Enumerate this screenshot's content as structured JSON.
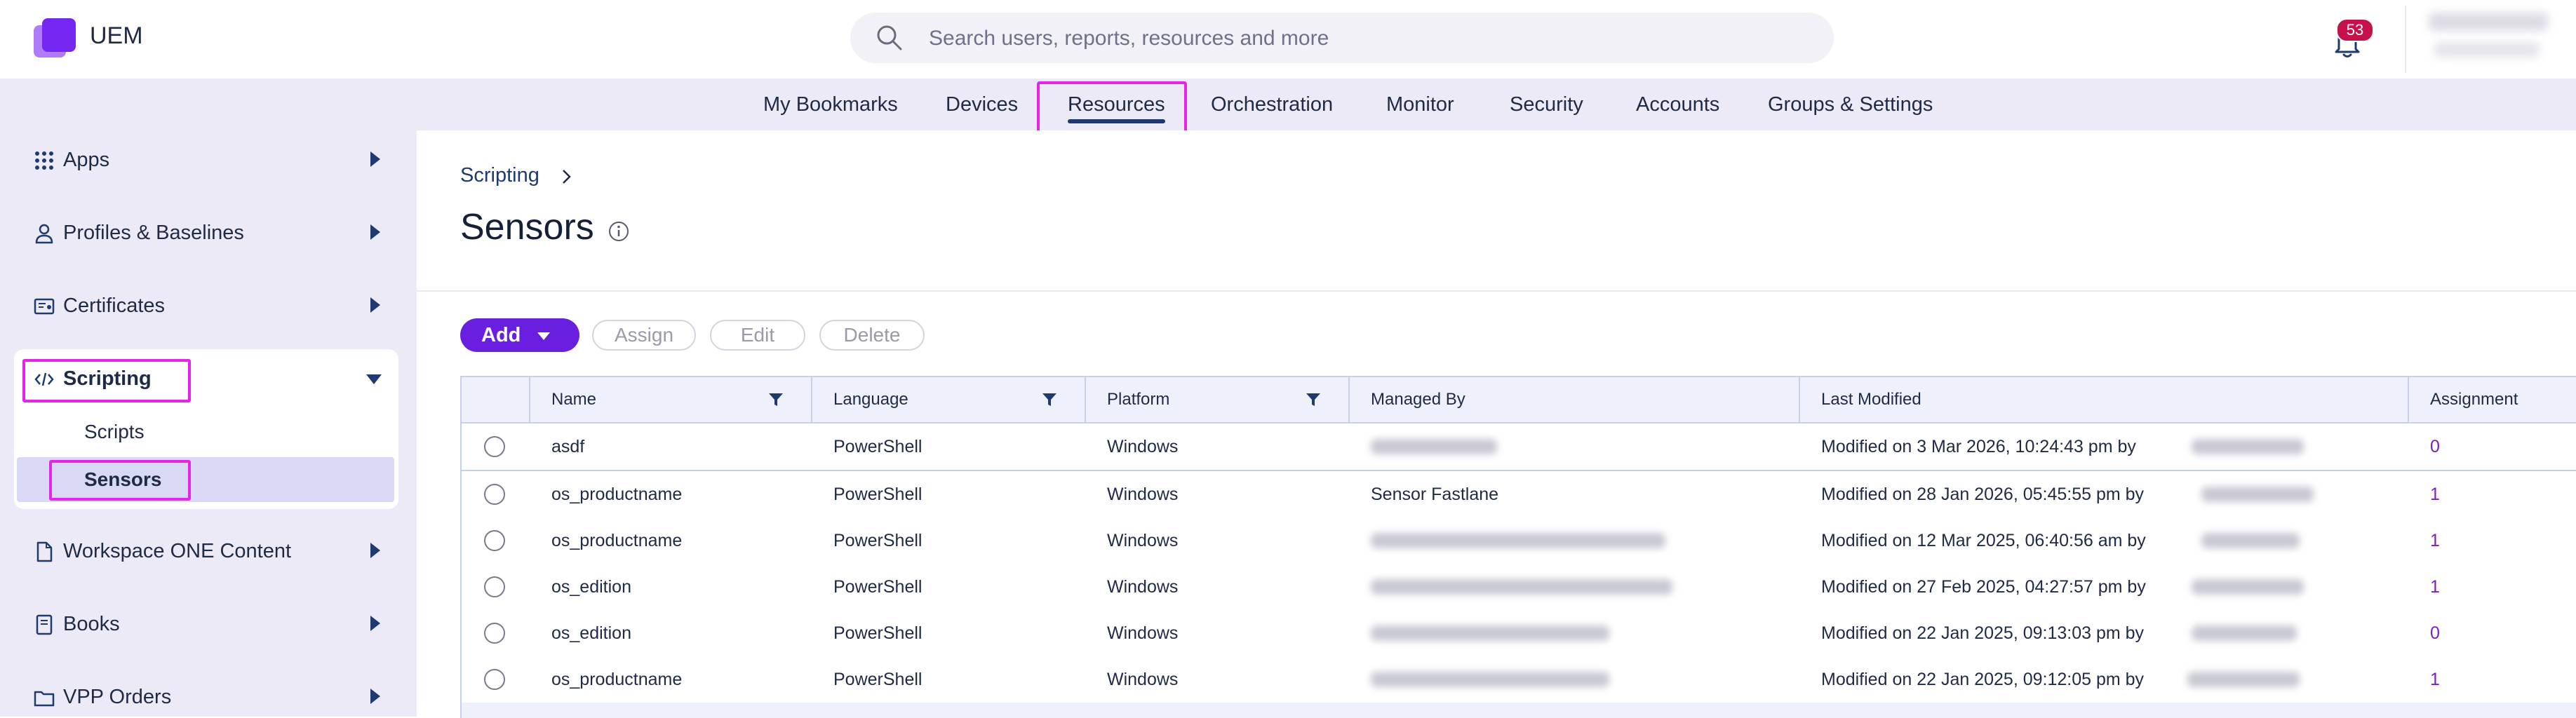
{
  "app": {
    "name": "UEM"
  },
  "search": {
    "placeholder": "Search users, reports, resources and more"
  },
  "notifications": {
    "count": "53"
  },
  "nav": {
    "items": [
      {
        "label": "My Bookmarks"
      },
      {
        "label": "Devices"
      },
      {
        "label": "Resources",
        "active": true
      },
      {
        "label": "Orchestration"
      },
      {
        "label": "Monitor"
      },
      {
        "label": "Security"
      },
      {
        "label": "Accounts"
      },
      {
        "label": "Groups & Settings"
      }
    ]
  },
  "sidebar": {
    "items": [
      {
        "label": "Apps",
        "icon": "grid-icon"
      },
      {
        "label": "Profiles & Baselines",
        "icon": "person-icon"
      },
      {
        "label": "Certificates",
        "icon": "certificate-icon"
      },
      {
        "label": "Scripting",
        "icon": "code-icon",
        "expanded": true
      },
      {
        "label": "Workspace ONE Content",
        "icon": "document-icon"
      },
      {
        "label": "Books",
        "icon": "book-icon"
      },
      {
        "label": "VPP Orders",
        "icon": "folder-icon"
      }
    ],
    "scripting_children": [
      {
        "label": "Scripts"
      },
      {
        "label": "Sensors",
        "active": true
      }
    ]
  },
  "breadcrumb": {
    "parent": "Scripting"
  },
  "page": {
    "title": "Sensors"
  },
  "toolbar": {
    "add": "Add",
    "assign": "Assign",
    "edit": "Edit",
    "delete": "Delete"
  },
  "table": {
    "columns": [
      "Name",
      "Language",
      "Platform",
      "Managed By",
      "Last Modified",
      "Assignment"
    ],
    "rows": [
      {
        "name": "asdf",
        "language": "PowerShell",
        "platform": "Windows",
        "managed_by": "",
        "last_modified": "Modified on 3 Mar 2026, 10:24:43 pm by",
        "assignment": "0"
      },
      {
        "name": "os_productname",
        "language": "PowerShell",
        "platform": "Windows",
        "managed_by": "Sensor Fastlane",
        "last_modified": "Modified on 28 Jan 2026, 05:45:55 pm by",
        "assignment": "1"
      },
      {
        "name": "os_productname",
        "language": "PowerShell",
        "platform": "Windows",
        "managed_by": "",
        "last_modified": "Modified on 12 Mar 2025, 06:40:56 am by",
        "assignment": "1"
      },
      {
        "name": "os_edition",
        "language": "PowerShell",
        "platform": "Windows",
        "managed_by": "",
        "last_modified": "Modified on 27 Feb 2025, 04:27:57 pm by",
        "assignment": "1"
      },
      {
        "name": "os_edition",
        "language": "PowerShell",
        "platform": "Windows",
        "managed_by": "",
        "last_modified": "Modified on 22 Jan 2025, 09:13:03 pm by",
        "assignment": "0"
      },
      {
        "name": "os_productname",
        "language": "PowerShell",
        "platform": "Windows",
        "managed_by": "",
        "last_modified": "Modified on 22 Jan 2025, 09:12:05 pm by",
        "assignment": "1"
      }
    ]
  },
  "colors": {
    "accent": "#6a1fe0",
    "highlight": "#e526e8",
    "nav_bg": "#eceaf7",
    "badge": "#c5124a"
  }
}
